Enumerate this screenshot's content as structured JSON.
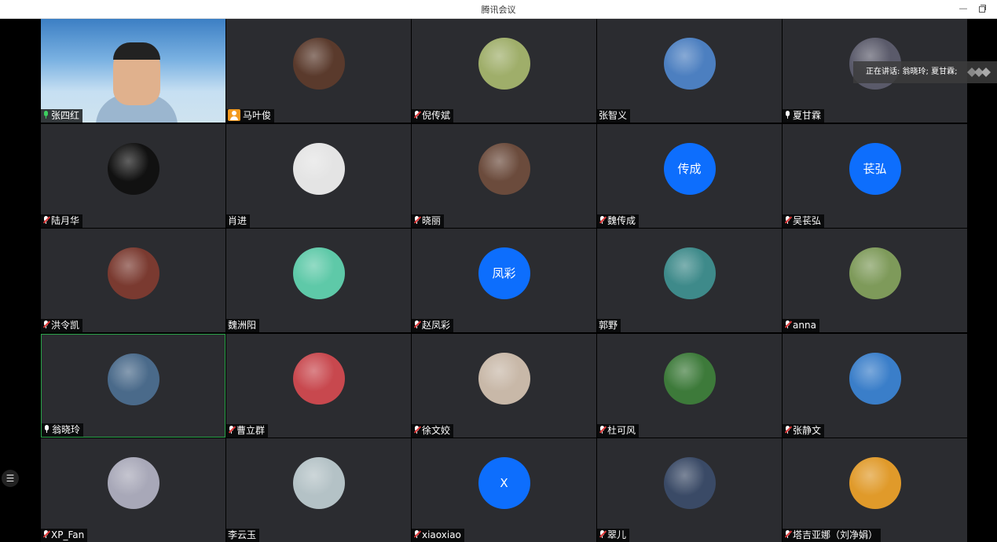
{
  "window": {
    "title": "腾讯会议"
  },
  "speaking_banner": "正在讲话: 翁晓玲; 夏甘霖;",
  "tiles": [
    {
      "name": "张四红",
      "mic": "green",
      "kind": "video"
    },
    {
      "name": "马叶俊",
      "mic": "person",
      "kind": "photo",
      "color": "#5a3a2c"
    },
    {
      "name": "倪传斌",
      "mic": "muted",
      "kind": "photo",
      "color": "#9fae6a"
    },
    {
      "name": "张智义",
      "mic": "none",
      "kind": "photo",
      "color": "#4c7fc0"
    },
    {
      "name": "夏甘霖",
      "mic": "on",
      "kind": "photo",
      "color": "#5a5a6a"
    },
    {
      "name": "陆月华",
      "mic": "muted",
      "kind": "photo",
      "color": "#111111"
    },
    {
      "name": "肖进",
      "mic": "none",
      "kind": "photo",
      "color": "#e4e4e4"
    },
    {
      "name": "晓丽",
      "mic": "muted",
      "kind": "photo",
      "color": "#6b4b3c"
    },
    {
      "name": "魏传成",
      "mic": "muted",
      "kind": "initials",
      "initials": "传成"
    },
    {
      "name": "吴苌弘",
      "mic": "muted",
      "kind": "initials",
      "initials": "苌弘"
    },
    {
      "name": "洪令凯",
      "mic": "muted",
      "kind": "photo",
      "color": "#7a3a30"
    },
    {
      "name": "魏洲阳",
      "mic": "none",
      "kind": "photo",
      "color": "#5ec9a8"
    },
    {
      "name": "赵凤彩",
      "mic": "muted",
      "kind": "initials",
      "initials": "凤彩"
    },
    {
      "name": "郭野",
      "mic": "none",
      "kind": "photo",
      "color": "#3e8a8a"
    },
    {
      "name": "anna",
      "mic": "muted",
      "kind": "photo",
      "color": "#7e9a5a"
    },
    {
      "name": "翁晓玲",
      "mic": "on",
      "kind": "photo",
      "color": "#4a6a8a",
      "active": true
    },
    {
      "name": "曹立群",
      "mic": "muted",
      "kind": "photo",
      "color": "#c8484e"
    },
    {
      "name": "徐文姣",
      "mic": "muted",
      "kind": "photo",
      "color": "#c8b8a8"
    },
    {
      "name": "杜可风",
      "mic": "muted",
      "kind": "photo",
      "color": "#3d7a3a"
    },
    {
      "name": "张静文",
      "mic": "muted",
      "kind": "photo",
      "color": "#3a7ec9"
    },
    {
      "name": "XP_Fan",
      "mic": "muted",
      "kind": "photo",
      "color": "#a8a8b8"
    },
    {
      "name": "李云玉",
      "mic": "none",
      "kind": "photo",
      "color": "#b4c2c6"
    },
    {
      "name": "xiaoxiao",
      "mic": "muted",
      "kind": "initials",
      "initials": "X"
    },
    {
      "name": "翠儿",
      "mic": "muted",
      "kind": "photo",
      "color": "#3a4a66"
    },
    {
      "name": "塔吉亚娜（刘净娟）",
      "mic": "muted",
      "kind": "photo",
      "color": "#e09a2a"
    }
  ],
  "side_button": "☰"
}
